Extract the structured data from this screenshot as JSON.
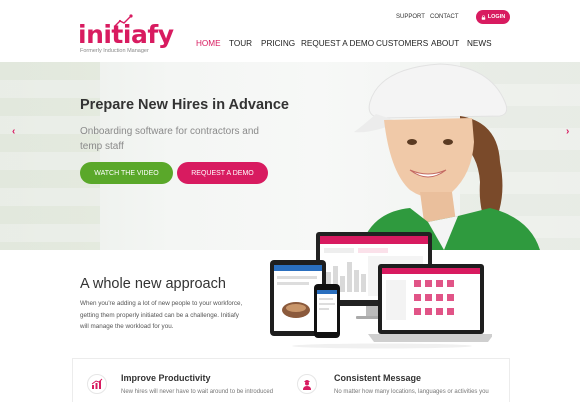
{
  "brand": {
    "name": "initiafy",
    "tagline": "Formerly Induction Manager",
    "accent": "#d81b60",
    "green": "#5aa82a"
  },
  "utility": {
    "support": "SUPPORT",
    "contact": "CONTACT",
    "login": "LOGIN"
  },
  "nav": {
    "items": [
      {
        "label": "HOME",
        "active": true
      },
      {
        "label": "TOUR"
      },
      {
        "label": "PRICING"
      },
      {
        "label": "REQUEST A DEMO"
      },
      {
        "label": "CUSTOMERS"
      },
      {
        "label": "ABOUT"
      },
      {
        "label": "NEWS"
      }
    ]
  },
  "hero": {
    "title": "Prepare New Hires in Advance",
    "subtitle": "Onboarding software for contractors and temp staff",
    "watch_label": "WATCH THE VIDEO",
    "demo_label": "REQUEST A DEMO",
    "prev_icon": "chevron-left-icon",
    "next_icon": "chevron-right-icon"
  },
  "approach": {
    "title": "A whole new approach",
    "body": "When you're adding a lot of new people to your workforce, getting them properly initiated can be a challenge. Initiafy will manage the workload for you."
  },
  "features": [
    {
      "icon": "chart-icon",
      "title": "Improve Productivity",
      "desc": "New hires will never have to wait around to be introduced"
    },
    {
      "icon": "worker-icon",
      "title": "Consistent Message",
      "desc": "No matter how many locations, languages or activities you"
    }
  ]
}
